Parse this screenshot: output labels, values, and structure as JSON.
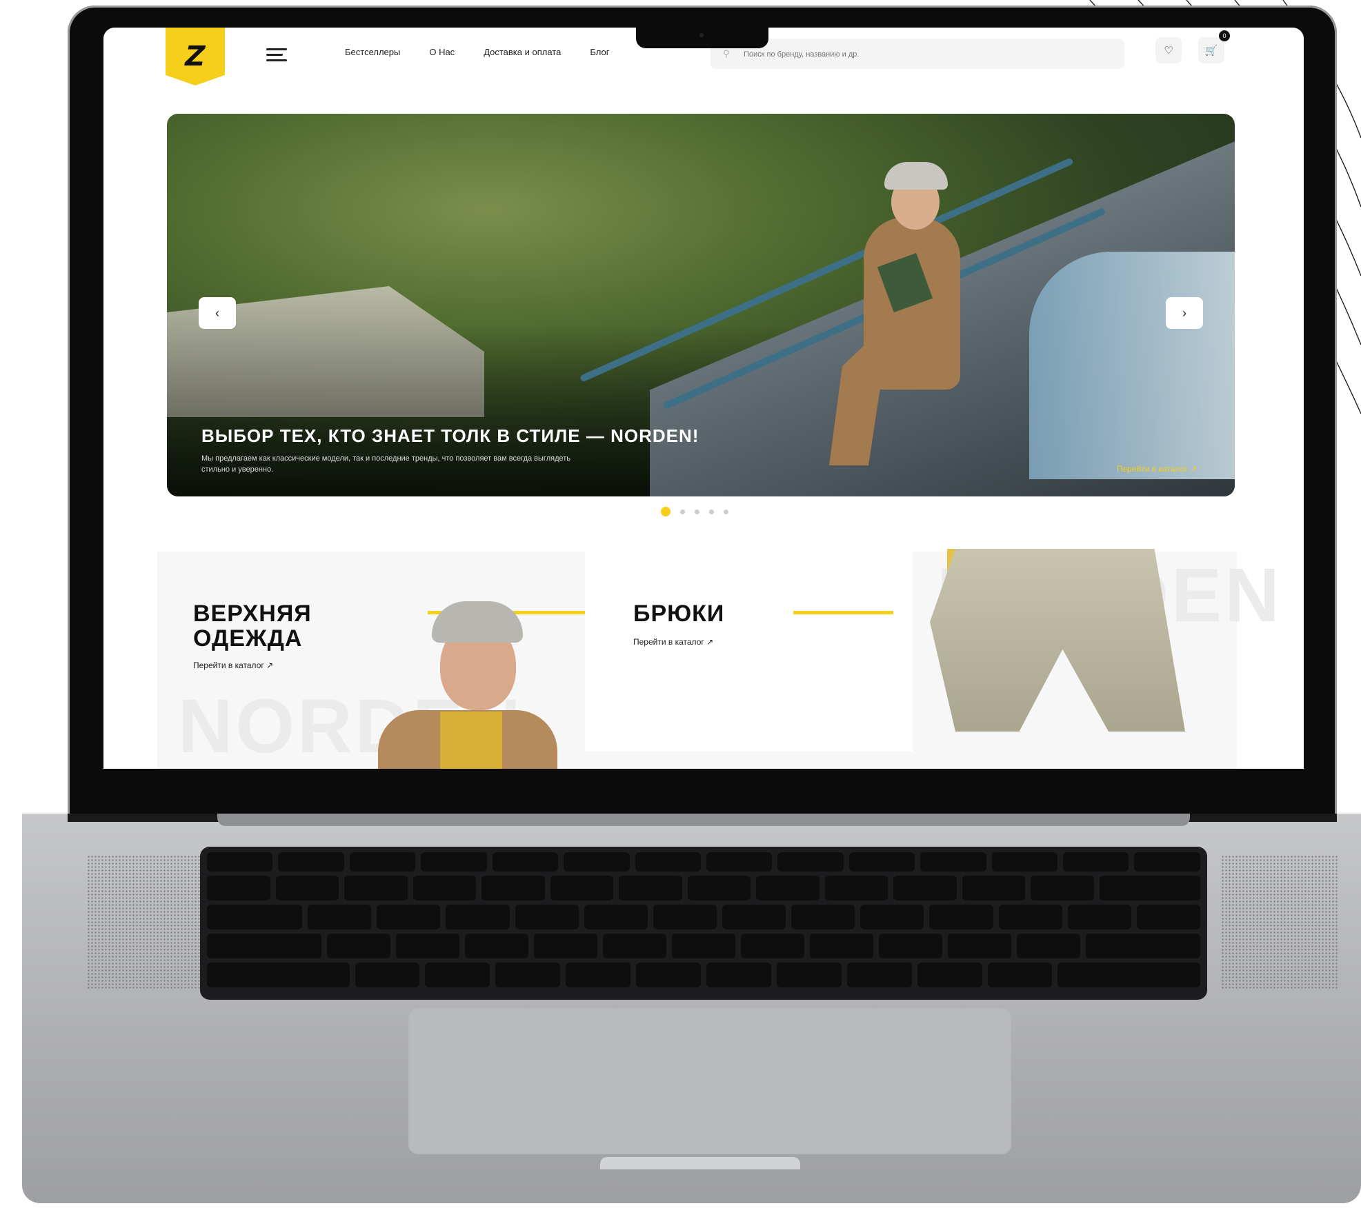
{
  "site": {
    "logo_letter": "Z",
    "nav": [
      "Бестселлеры",
      "О Нас",
      "Доставка и оплата",
      "Блог"
    ],
    "search_placeholder": "Поиск по бренду, названию и др.",
    "icons": [
      "menu-icon",
      "search-icon",
      "heart-icon",
      "cart-icon"
    ],
    "cart_count": "0"
  },
  "hero": {
    "title": "ВЫБОР ТЕХ, КТО ЗНАЕТ ТОЛК В СТИЛЕ — NORDEN!",
    "subtitle": "Мы предлагаем как классические модели, так и последние тренды, что позволяет вам всегда выглядеть стильно и уверенно.",
    "link": "Перейти в каталог ↗",
    "prev": "‹",
    "next": "›",
    "slides_total": 5,
    "active_slide": 1
  },
  "categories": [
    {
      "title_line1": "ВЕРХНЯЯ",
      "title_line2": "ОДЕЖДА",
      "link": "Перейти в каталог ↗",
      "bg_text": "NORDEN"
    },
    {
      "title_line1": "БРЮКИ",
      "link": "Перейти в каталог ↗",
      "bg_text": "NORDEN"
    }
  ],
  "colors": {
    "accent": "#f5cf1b",
    "laptop_frame": "#0b0b0c",
    "laptop_body": "#adaeb1"
  }
}
